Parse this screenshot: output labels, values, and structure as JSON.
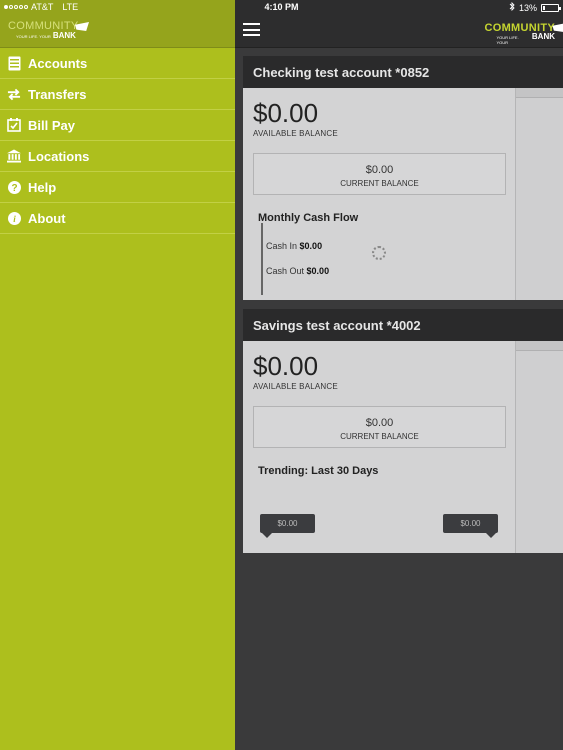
{
  "status": {
    "carrier": "AT&T",
    "network": "LTE",
    "time": "4:10 PM",
    "battery": "13%",
    "battery_level": 0.13
  },
  "brand": {
    "name": "COMMUNITY",
    "tagline": "YOUR LIFE. YOUR",
    "bank": "BANK"
  },
  "sidebar": {
    "items": [
      {
        "label": "Accounts",
        "icon": "accounts-icon"
      },
      {
        "label": "Transfers",
        "icon": "transfers-icon"
      },
      {
        "label": "Bill Pay",
        "icon": "calendar-check-icon"
      },
      {
        "label": "Locations",
        "icon": "bank-building-icon"
      },
      {
        "label": "Help",
        "icon": "question-icon"
      },
      {
        "label": "About",
        "icon": "info-icon"
      }
    ]
  },
  "accounts": [
    {
      "title": "Checking test account *0852",
      "available_balance": "$0.00",
      "available_label": "AVAILABLE BALANCE",
      "current_balance": "$0.00",
      "current_label": "CURRENT BALANCE",
      "section_title": "Monthly Cash Flow",
      "cash_in_label": "Cash In",
      "cash_in_value": "$0.00",
      "cash_out_label": "Cash Out",
      "cash_out_value": "$0.00"
    },
    {
      "title": "Savings test account *4002",
      "available_balance": "$0.00",
      "available_label": "AVAILABLE BALANCE",
      "current_balance": "$0.00",
      "current_label": "CURRENT BALANCE",
      "section_title": "Trending: Last 30 Days",
      "trend_start": "$0.00",
      "trend_end": "$0.00"
    }
  ],
  "colors": {
    "sidebar_bg": "#adbf1d",
    "header_bg": "#2d2d2e",
    "main_bg": "#3a3a3b",
    "card_bg": "#d3d3d4"
  }
}
